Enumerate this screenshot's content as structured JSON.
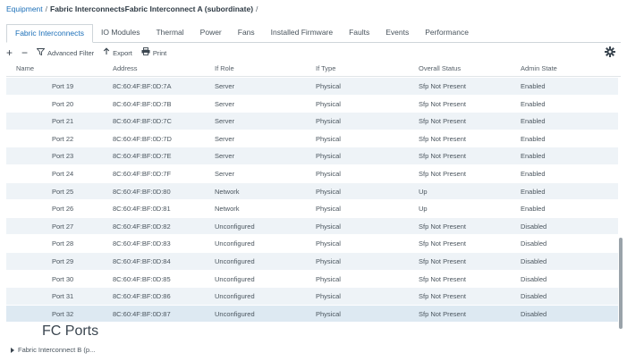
{
  "breadcrumb": {
    "root": "Equipment",
    "sep1": "/",
    "level2": "Fabric Interconnects",
    "level3": "Fabric Interconnect A (subordinate)",
    "sep2": "/"
  },
  "tabs": [
    {
      "label": "Fabric Interconnects",
      "active": true
    },
    {
      "label": "IO Modules"
    },
    {
      "label": "Thermal"
    },
    {
      "label": "Power"
    },
    {
      "label": "Fans"
    },
    {
      "label": "Installed Firmware"
    },
    {
      "label": "Faults"
    },
    {
      "label": "Events"
    },
    {
      "label": "Performance"
    }
  ],
  "toolbar": {
    "add_label": "+",
    "remove_label": "−",
    "filter_label": "Advanced Filter",
    "export_label": "Export",
    "print_label": "Print"
  },
  "columns": {
    "name": "Name",
    "address": "Address",
    "if_role": "If Role",
    "if_type": "If Type",
    "overall_status": "Overall Status",
    "admin_state": "Admin State"
  },
  "rows": [
    {
      "name": "Port 19",
      "address": "8C:60:4F:BF:0D:7A",
      "role": "Server",
      "type": "Physical",
      "status": "Sfp Not Present",
      "admin": "Enabled"
    },
    {
      "name": "Port 20",
      "address": "8C:60:4F:BF:0D:7B",
      "role": "Server",
      "type": "Physical",
      "status": "Sfp Not Present",
      "admin": "Enabled"
    },
    {
      "name": "Port 21",
      "address": "8C:60:4F:BF:0D:7C",
      "role": "Server",
      "type": "Physical",
      "status": "Sfp Not Present",
      "admin": "Enabled"
    },
    {
      "name": "Port 22",
      "address": "8C:60:4F:BF:0D:7D",
      "role": "Server",
      "type": "Physical",
      "status": "Sfp Not Present",
      "admin": "Enabled"
    },
    {
      "name": "Port 23",
      "address": "8C:60:4F:BF:0D:7E",
      "role": "Server",
      "type": "Physical",
      "status": "Sfp Not Present",
      "admin": "Enabled"
    },
    {
      "name": "Port 24",
      "address": "8C:60:4F:BF:0D:7F",
      "role": "Server",
      "type": "Physical",
      "status": "Sfp Not Present",
      "admin": "Enabled"
    },
    {
      "name": "Port 25",
      "address": "8C:60:4F:BF:0D:80",
      "role": "Network",
      "type": "Physical",
      "status": "Up",
      "admin": "Enabled"
    },
    {
      "name": "Port 26",
      "address": "8C:60:4F:BF:0D:81",
      "role": "Network",
      "type": "Physical",
      "status": "Up",
      "admin": "Enabled"
    },
    {
      "name": "Port 27",
      "address": "8C:60:4F:BF:0D:82",
      "role": "Unconfigured",
      "type": "Physical",
      "status": "Sfp Not Present",
      "admin": "Disabled"
    },
    {
      "name": "Port 28",
      "address": "8C:60:4F:BF:0D:83",
      "role": "Unconfigured",
      "type": "Physical",
      "status": "Sfp Not Present",
      "admin": "Disabled"
    },
    {
      "name": "Port 29",
      "address": "8C:60:4F:BF:0D:84",
      "role": "Unconfigured",
      "type": "Physical",
      "status": "Sfp Not Present",
      "admin": "Disabled"
    },
    {
      "name": "Port 30",
      "address": "8C:60:4F:BF:0D:85",
      "role": "Unconfigured",
      "type": "Physical",
      "status": "Sfp Not Present",
      "admin": "Disabled"
    },
    {
      "name": "Port 31",
      "address": "8C:60:4F:BF:0D:86",
      "role": "Unconfigured",
      "type": "Physical",
      "status": "Sfp Not Present",
      "admin": "Disabled"
    },
    {
      "name": "Port 32",
      "address": "8C:60:4F:BF:0D:87",
      "role": "Unconfigured",
      "type": "Physical",
      "status": "Sfp Not Present",
      "admin": "Disabled",
      "selected": true
    }
  ],
  "fc_ports_label": "FC Ports",
  "tree": {
    "fabric_b_label": "Fabric Interconnect B (p..."
  },
  "colors": {
    "accent": "#1b6fb8",
    "row_stripe": "#eef3f7",
    "row_selected": "#dde9f2"
  }
}
